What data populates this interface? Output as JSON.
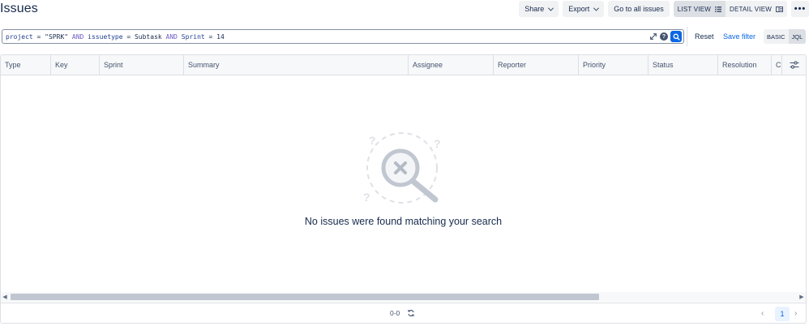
{
  "page": {
    "title": "Issues"
  },
  "toolbar": {
    "share_label": "Share",
    "export_label": "Export",
    "all_issues_label": "Go to all issues",
    "list_view_label": "LIST VIEW",
    "detail_view_label": "DETAIL VIEW",
    "list_view_icon": "list-icon",
    "detail_view_icon": "detail-view-icon",
    "more_label": "•••"
  },
  "jql": {
    "tokens": {
      "t1": "project",
      "t2": " = ",
      "t3": "\"SPRK\"",
      "t4": " AND ",
      "t5": "issuetype",
      "t6": " = ",
      "t7": "Subtask",
      "t8": " AND ",
      "t9": "Sprint",
      "t10": " = ",
      "t11": "14"
    },
    "expand_icon": "expand-icon",
    "help_label": "?",
    "search_icon": "search-icon"
  },
  "filter": {
    "reset_label": "Reset",
    "save_label": "Save filter",
    "basic_label": "BASIC",
    "jql_label": "JQL"
  },
  "table": {
    "columns": {
      "type": "Type",
      "key": "Key",
      "sprint": "Sprint",
      "summary": "Summary",
      "assignee": "Assignee",
      "reporter": "Reporter",
      "priority": "Priority",
      "status": "Status",
      "resolution": "Resolution",
      "created": "Cr"
    },
    "settings_icon": "column-settings-icon",
    "empty_message": "No issues were found matching your search"
  },
  "footer": {
    "count": "0-0",
    "refresh_icon": "refresh-icon",
    "current_page": "1"
  },
  "colors": {
    "primary": "#0c66e4",
    "text": "#172b4d",
    "subtle": "#44546f",
    "border": "#dcdfe4",
    "button_bg": "#f1f2f4",
    "keyword": "#6e5dc6"
  }
}
